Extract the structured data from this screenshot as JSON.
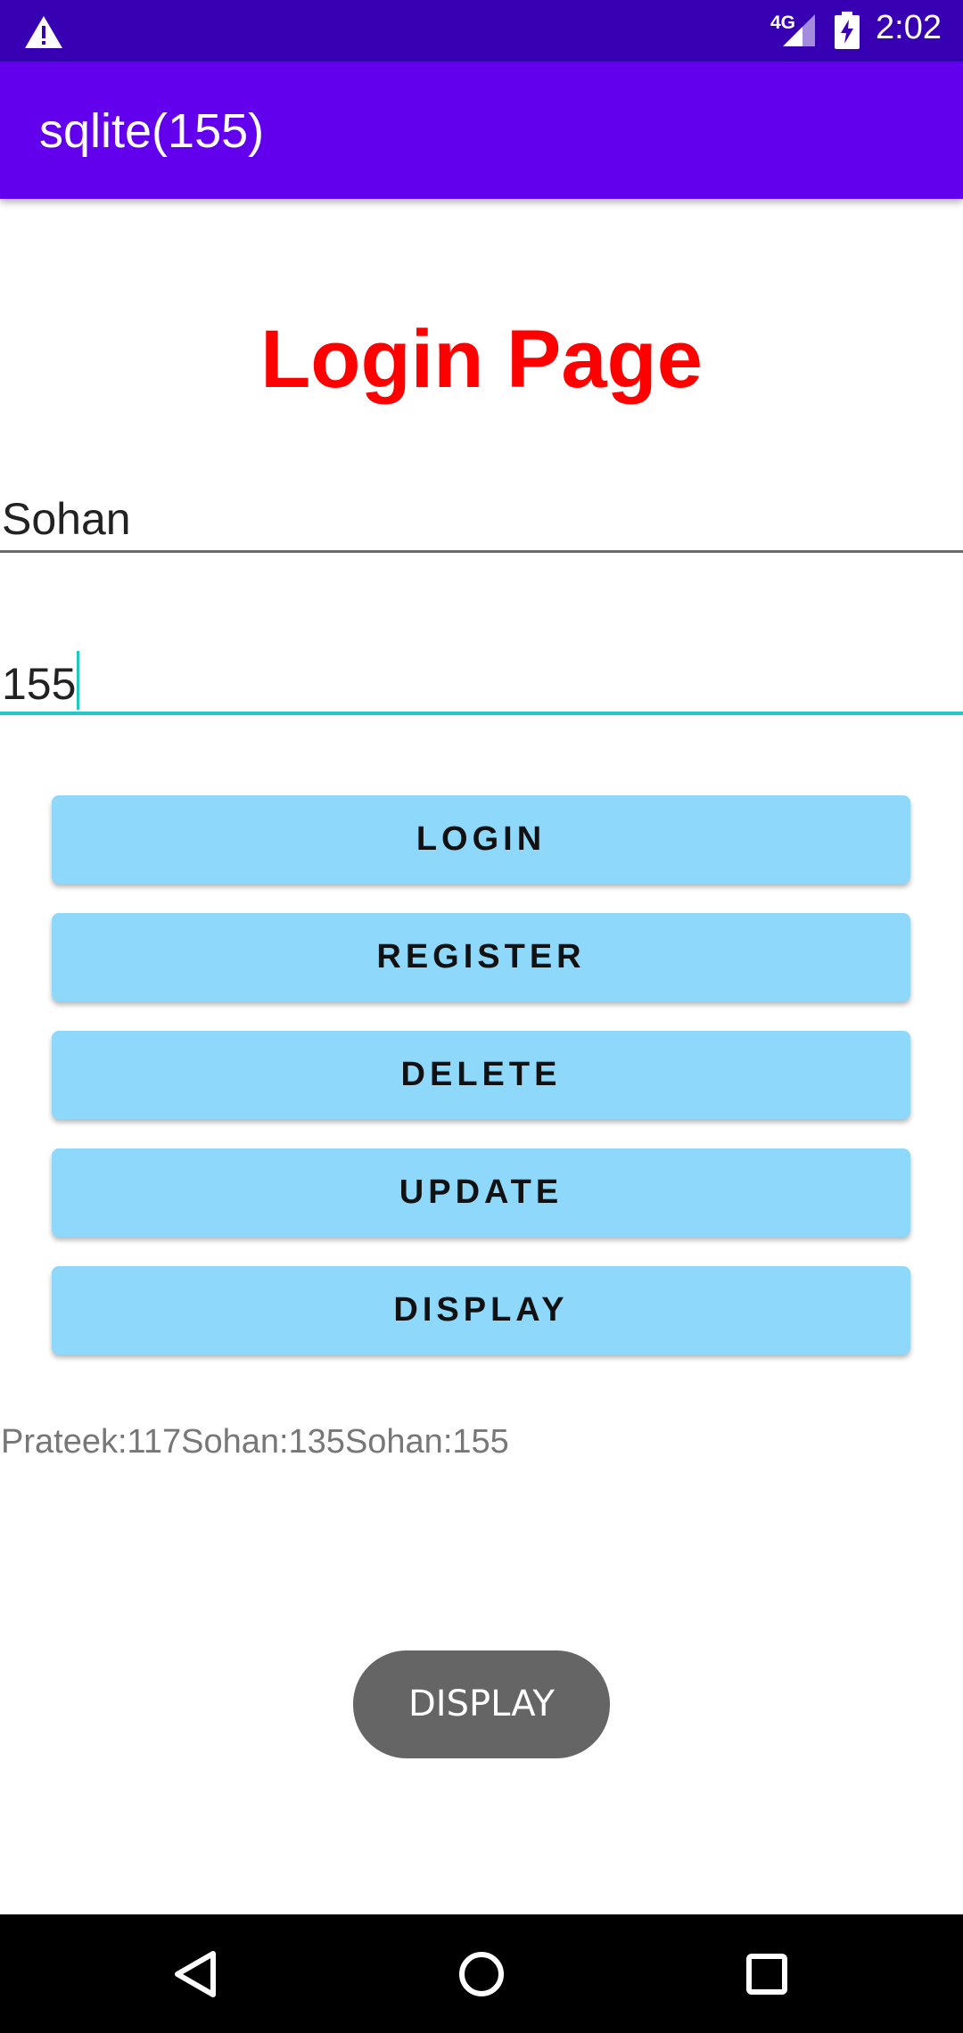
{
  "status_bar": {
    "network_label": "4G",
    "time": "2:02",
    "icons": [
      "warning-icon",
      "signal-icon",
      "battery-charging-icon"
    ]
  },
  "app_bar": {
    "title": "sqlite(155)",
    "color": "#6200ee"
  },
  "heading": {
    "text": "Login Page",
    "color": "#ff0000"
  },
  "form": {
    "username_value": "Sohan",
    "password_value": "155"
  },
  "buttons": {
    "login": "LOGIN",
    "register": "REGISTER",
    "delete": "DELETE",
    "update": "UPDATE",
    "display": "DISPLAY"
  },
  "result": {
    "text": "Prateek:117Sohan:135Sohan:155"
  },
  "toast": {
    "text": "DISPLAY"
  },
  "nav_bar": {
    "icons": [
      "back-icon",
      "home-icon",
      "recents-icon"
    ]
  }
}
